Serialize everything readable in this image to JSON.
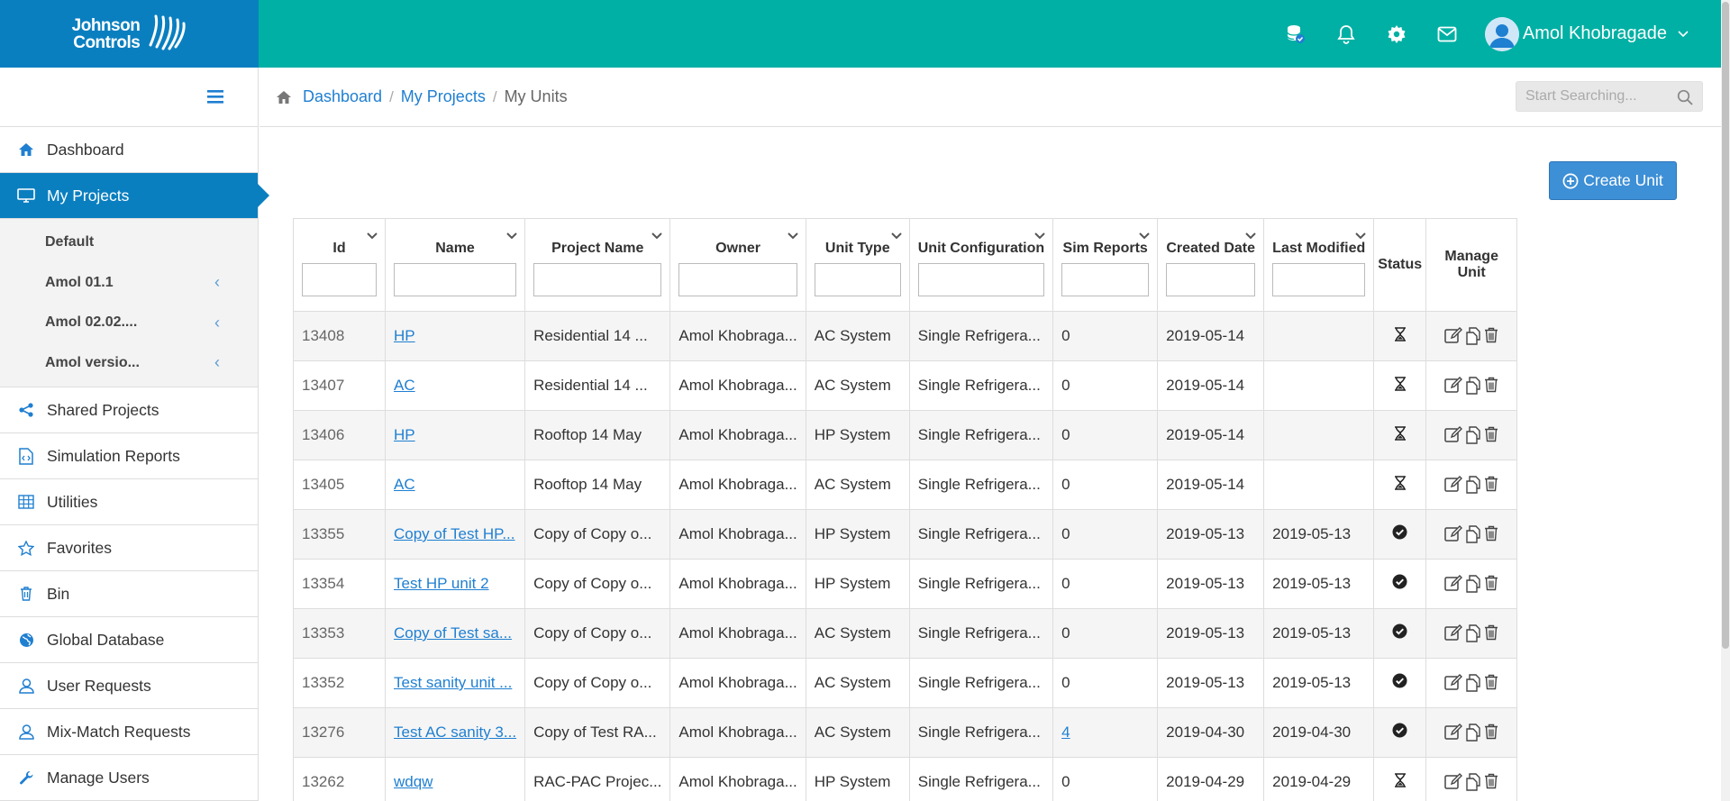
{
  "brand": {
    "line1": "Johnson",
    "line2": "Controls"
  },
  "header": {
    "icons": [
      "database-check-icon",
      "bell-icon",
      "gear-icon",
      "mail-icon"
    ],
    "user_name": "Amol Khobragade"
  },
  "sidebar": {
    "items": [
      {
        "label": "Dashboard",
        "icon": "home-icon"
      },
      {
        "label": "My Projects",
        "icon": "monitor-icon",
        "active": true
      },
      {
        "label": "Shared Projects",
        "icon": "share-icon"
      },
      {
        "label": "Simulation Reports",
        "icon": "code-file-icon"
      },
      {
        "label": "Utilities",
        "icon": "grid-icon"
      },
      {
        "label": "Favorites",
        "icon": "star-icon"
      },
      {
        "label": "Bin",
        "icon": "trash-icon"
      },
      {
        "label": "Global Database",
        "icon": "globe-icon"
      },
      {
        "label": "User Requests",
        "icon": "user-icon"
      },
      {
        "label": "Mix-Match Requests",
        "icon": "user-icon"
      },
      {
        "label": "Manage Users",
        "icon": "wrench-icon"
      }
    ],
    "subitems": [
      {
        "label": "Default",
        "has_chevron": false
      },
      {
        "label": "Amol 01.1",
        "has_chevron": true
      },
      {
        "label": "Amol 02.02....",
        "has_chevron": true
      },
      {
        "label": "Amol versio...",
        "has_chevron": true
      }
    ]
  },
  "breadcrumb": {
    "dashboard": "Dashboard",
    "projects": "My Projects",
    "current": "My Units",
    "sep": "/"
  },
  "search": {
    "placeholder": "Start Searching..."
  },
  "create_button": "Create Unit",
  "table": {
    "columns": [
      "Id",
      "Name",
      "Project Name",
      "Owner",
      "Unit Type",
      "Unit Configuration",
      "Sim Reports",
      "Created Date",
      "Last Modified",
      "Status",
      "Manage Unit"
    ],
    "rows": [
      {
        "id": "13408",
        "name": "HP",
        "project": "Residential 14 ...",
        "owner": "Amol Khobraga...",
        "type": "AC System",
        "config": "Single Refrigera...",
        "sim": "0",
        "sim_link": false,
        "created": "2019-05-14",
        "modified": "",
        "status": "pending"
      },
      {
        "id": "13407",
        "name": "AC",
        "project": "Residential 14 ...",
        "owner": "Amol Khobraga...",
        "type": "AC System",
        "config": "Single Refrigera...",
        "sim": "0",
        "sim_link": false,
        "created": "2019-05-14",
        "modified": "",
        "status": "pending"
      },
      {
        "id": "13406",
        "name": "HP",
        "project": "Rooftop 14 May",
        "owner": "Amol Khobraga...",
        "type": "HP System",
        "config": "Single Refrigera...",
        "sim": "0",
        "sim_link": false,
        "created": "2019-05-14",
        "modified": "",
        "status": "pending"
      },
      {
        "id": "13405",
        "name": "AC",
        "project": "Rooftop 14 May",
        "owner": "Amol Khobraga...",
        "type": "AC System",
        "config": "Single Refrigera...",
        "sim": "0",
        "sim_link": false,
        "created": "2019-05-14",
        "modified": "",
        "status": "pending"
      },
      {
        "id": "13355",
        "name": "Copy of Test HP...",
        "project": "Copy of Copy o...",
        "owner": "Amol Khobraga...",
        "type": "HP System",
        "config": "Single Refrigera...",
        "sim": "0",
        "sim_link": false,
        "created": "2019-05-13",
        "modified": "2019-05-13",
        "status": "done"
      },
      {
        "id": "13354",
        "name": "Test HP unit 2",
        "project": "Copy of Copy o...",
        "owner": "Amol Khobraga...",
        "type": "HP System",
        "config": "Single Refrigera...",
        "sim": "0",
        "sim_link": false,
        "created": "2019-05-13",
        "modified": "2019-05-13",
        "status": "done"
      },
      {
        "id": "13353",
        "name": "Copy of Test sa...",
        "project": "Copy of Copy o...",
        "owner": "Amol Khobraga...",
        "type": "AC System",
        "config": "Single Refrigera...",
        "sim": "0",
        "sim_link": false,
        "created": "2019-05-13",
        "modified": "2019-05-13",
        "status": "done"
      },
      {
        "id": "13352",
        "name": "Test sanity unit ...",
        "project": "Copy of Copy o...",
        "owner": "Amol Khobraga...",
        "type": "AC System",
        "config": "Single Refrigera...",
        "sim": "0",
        "sim_link": false,
        "created": "2019-05-13",
        "modified": "2019-05-13",
        "status": "done"
      },
      {
        "id": "13276",
        "name": "Test AC sanity 3...",
        "project": "Copy of Test RA...",
        "owner": "Amol Khobraga...",
        "type": "AC System",
        "config": "Single Refrigera...",
        "sim": "4",
        "sim_link": true,
        "created": "2019-04-30",
        "modified": "2019-04-30",
        "status": "done"
      },
      {
        "id": "13262",
        "name": "wdqw",
        "project": "RAC-PAC Projec...",
        "owner": "Amol Khobraga...",
        "type": "HP System",
        "config": "Single Refrigera...",
        "sim": "0",
        "sim_link": false,
        "created": "2019-04-29",
        "modified": "2019-04-29",
        "status": "pending"
      }
    ]
  },
  "colors": {
    "header_teal": "#00b0a4",
    "brand_blue": "#0a7fc0",
    "link_blue": "#1f7fd1",
    "button_blue": "#3d8fd6"
  }
}
